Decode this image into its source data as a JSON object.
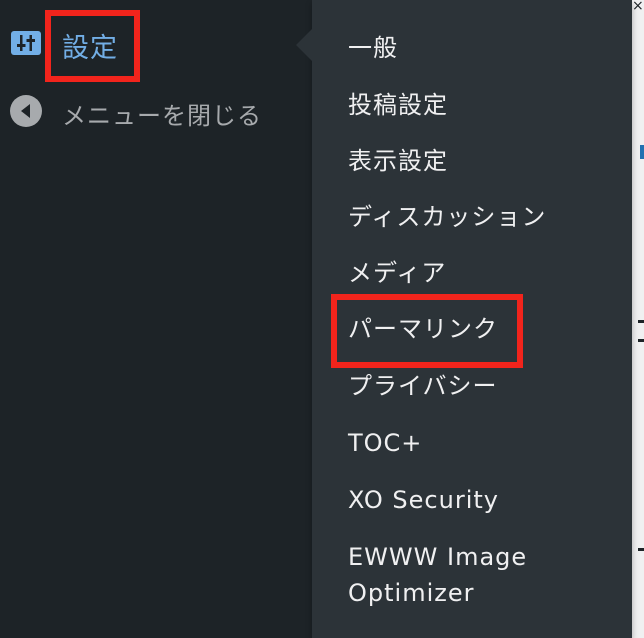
{
  "sidebar": {
    "settings_label": "設定",
    "collapse_label": "メニューを閉じる"
  },
  "submenu": {
    "items": [
      "一般",
      "投稿設定",
      "表示設定",
      "ディスカッション",
      "メディア",
      "パーマリンク",
      "プライバシー",
      "TOC+",
      "XO Security",
      "EWWW Image",
      "Optimizer"
    ]
  },
  "background": {
    "close_glyph": "×"
  },
  "colors": {
    "sidebar_bg": "#1d2327",
    "submenu_bg": "#2c3338",
    "accent": "#72aee6",
    "highlight": "#f2241c",
    "text": "#f0f0f1",
    "muted": "#a7aaad"
  }
}
